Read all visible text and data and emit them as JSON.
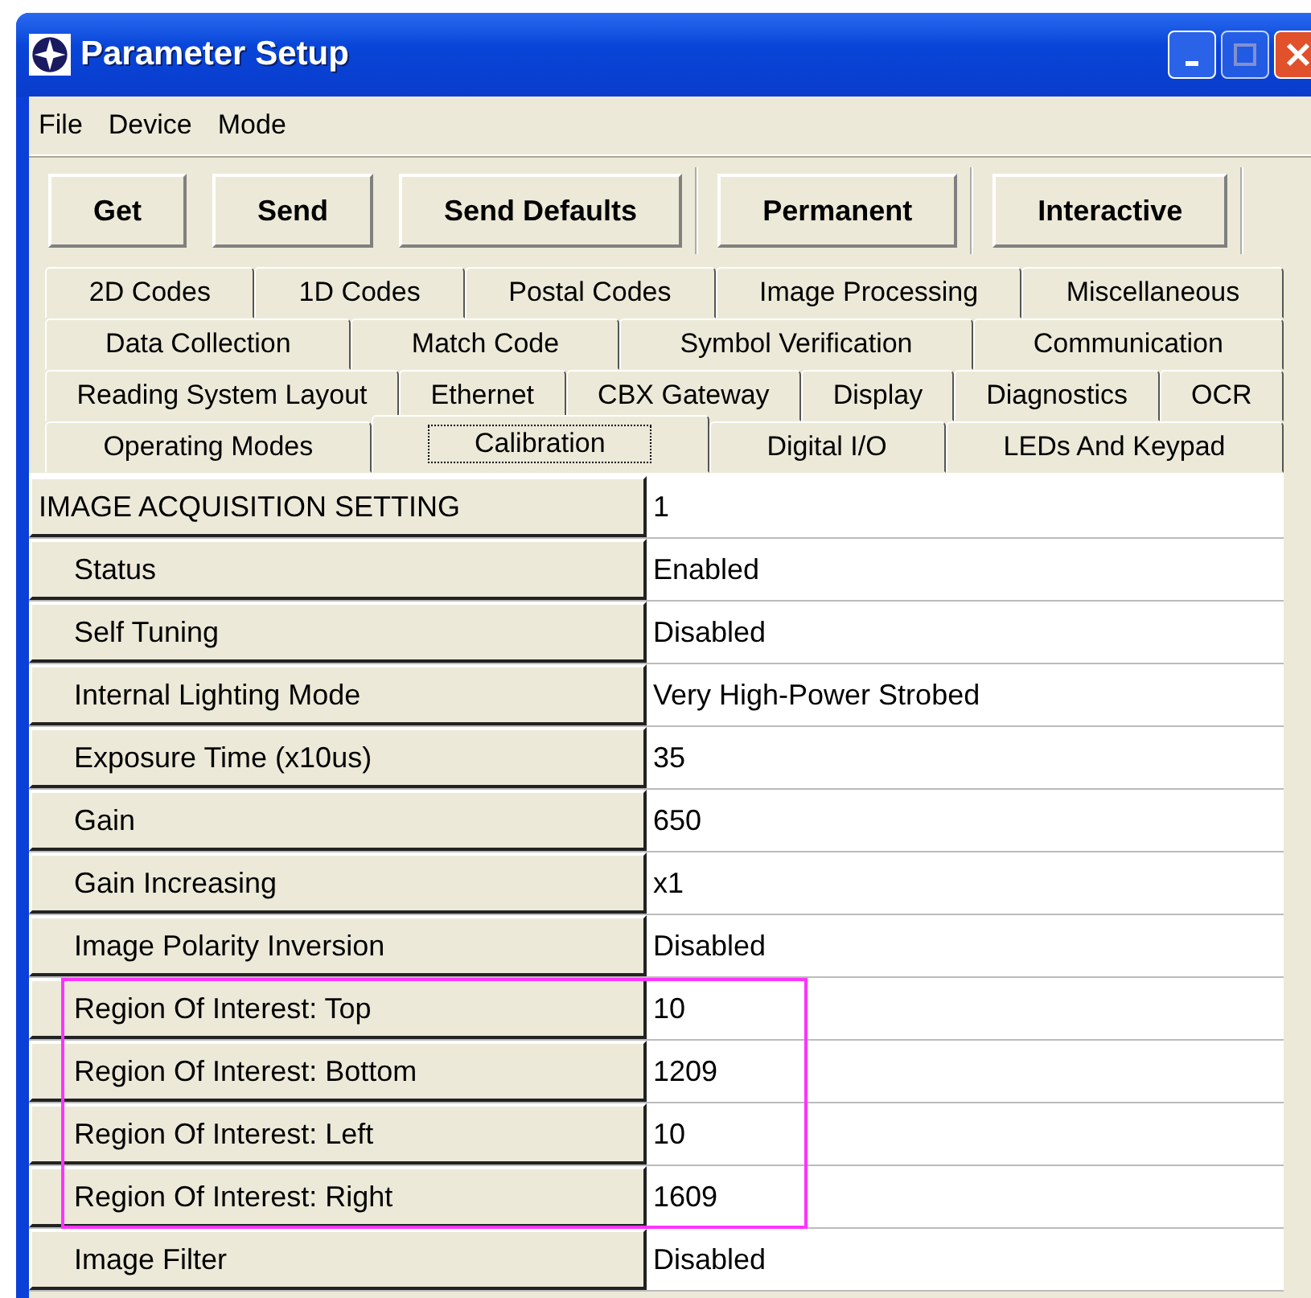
{
  "window": {
    "title": "Parameter Setup"
  },
  "menu": [
    "File",
    "Device",
    "Mode"
  ],
  "toolbar": [
    [
      "Get",
      "Send",
      "Send Defaults"
    ],
    [
      "Permanent"
    ],
    [
      "Interactive"
    ]
  ],
  "tab_rows": [
    [
      {
        "label": "2D Codes",
        "selected": false
      },
      {
        "label": "1D Codes",
        "selected": false
      },
      {
        "label": "Postal Codes",
        "selected": false
      },
      {
        "label": "Image Processing",
        "selected": false
      },
      {
        "label": "Miscellaneous",
        "selected": false
      }
    ],
    [
      {
        "label": "Data Collection",
        "selected": false
      },
      {
        "label": "Match Code",
        "selected": false
      },
      {
        "label": "Symbol Verification",
        "selected": false
      },
      {
        "label": "Communication",
        "selected": false
      }
    ],
    [
      {
        "label": "Reading System Layout",
        "selected": false
      },
      {
        "label": "Ethernet",
        "selected": false
      },
      {
        "label": "CBX Gateway",
        "selected": false
      },
      {
        "label": "Display",
        "selected": false
      },
      {
        "label": "Diagnostics",
        "selected": false
      },
      {
        "label": "OCR",
        "selected": false
      }
    ],
    [
      {
        "label": "Operating Modes",
        "selected": false
      },
      {
        "label": "Calibration",
        "selected": true
      },
      {
        "label": "Digital I/O",
        "selected": false
      },
      {
        "label": "LEDs And Keypad",
        "selected": false
      }
    ]
  ],
  "rows": [
    {
      "kind": "header",
      "name": "IMAGE ACQUISITION SETTING",
      "value": "1",
      "highlighted": false
    },
    {
      "kind": "param",
      "name": "Status",
      "value": "Enabled",
      "highlighted": false
    },
    {
      "kind": "param",
      "name": "Self Tuning",
      "value": "Disabled",
      "highlighted": false
    },
    {
      "kind": "param",
      "name": "Internal Lighting Mode",
      "value": "Very High-Power Strobed",
      "highlighted": false
    },
    {
      "kind": "param",
      "name": "Exposure Time (x10us)",
      "value": "35",
      "highlighted": false
    },
    {
      "kind": "param",
      "name": "Gain",
      "value": "650",
      "highlighted": false
    },
    {
      "kind": "param",
      "name": "Gain Increasing",
      "value": "x1",
      "highlighted": false
    },
    {
      "kind": "param",
      "name": "Image Polarity Inversion",
      "value": "Disabled",
      "highlighted": false
    },
    {
      "kind": "param",
      "name": "Region Of Interest: Top",
      "value": "10",
      "highlighted": true
    },
    {
      "kind": "param",
      "name": "Region Of Interest: Bottom",
      "value": "1209",
      "highlighted": true
    },
    {
      "kind": "param",
      "name": "Region Of Interest: Left",
      "value": "10",
      "highlighted": true
    },
    {
      "kind": "param",
      "name": "Region Of Interest: Right",
      "value": "1609",
      "highlighted": true
    },
    {
      "kind": "param",
      "name": "Image Filter",
      "value": "Disabled",
      "highlighted": false
    }
  ]
}
